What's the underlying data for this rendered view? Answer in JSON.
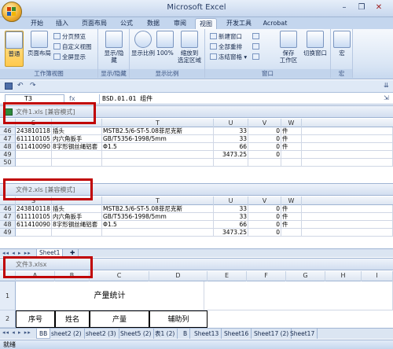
{
  "app": {
    "title": "Microsoft Excel"
  },
  "ribbon": {
    "tabs": [
      "开始",
      "插入",
      "页面布局",
      "公式",
      "数据",
      "审阅",
      "视图",
      "开发工具",
      "Acrobat"
    ],
    "active_tab": "视图",
    "groups": {
      "workbook_views": {
        "label": "工作簿视图",
        "normal": "普通",
        "page_layout": "页面布局",
        "page_break": "分页预览",
        "custom_views": "自定义视图",
        "full_screen": "全屏显示"
      },
      "show_hide": {
        "label": "显示/隐藏"
      },
      "zoom": {
        "label": "显示比例",
        "zoom": "显示比例",
        "zoom100": "100%",
        "zoom_selection_line1": "缩放到",
        "zoom_selection_line2": "选定区域"
      },
      "window": {
        "label": "窗口",
        "new_window": "新建窗口",
        "arrange_all": "全部重排",
        "freeze_panes": "冻结窗格",
        "save_workspace_line1": "保存",
        "save_workspace_line2": "工作区",
        "switch_windows": "切换窗口"
      },
      "macros": {
        "label": "宏",
        "macros": "宏"
      }
    }
  },
  "formula_bar": {
    "name_box": "T3",
    "fx": "fx",
    "value": "BSD.01.01 组件"
  },
  "windows": [
    {
      "title": "文件1.xls [兼容模式]",
      "columns": [
        "S",
        "T",
        "U",
        "V",
        "W"
      ],
      "rows": [
        {
          "n": "46",
          "cells": [
            "243810118",
            "插头",
            "MSTB2.5/6-ST-5.08菲尼克斯",
            "33",
            "0",
            "件"
          ]
        },
        {
          "n": "47",
          "cells": [
            "611110105",
            "内六角扳手",
            "GB/T5356-1998/5mm",
            "33",
            "0",
            "件"
          ]
        },
        {
          "n": "48",
          "cells": [
            "611410090",
            "8字形钢丝绳铝套",
            "Φ1.5",
            "66",
            "0",
            "件"
          ]
        },
        {
          "n": "49",
          "cells": [
            "",
            "",
            "",
            "3473.25",
            "0",
            ""
          ]
        },
        {
          "n": "50",
          "cells": [
            "",
            "",
            "",
            "",
            "",
            ""
          ]
        }
      ]
    },
    {
      "title": "文件2.xls [兼容模式]",
      "rows": [
        {
          "n": "46",
          "cells": [
            "243810118",
            "插头",
            "MSTB2.5/6-ST-5.08菲尼克斯",
            "33",
            "0",
            "件"
          ]
        },
        {
          "n": "47",
          "cells": [
            "611110105",
            "内六角扳手",
            "GB/T5356-1998/5mm",
            "33",
            "0",
            "件"
          ]
        },
        {
          "n": "48",
          "cells": [
            "611410090",
            "8字形钢丝绳铝套",
            "Φ1.5",
            "66",
            "0",
            "件"
          ]
        },
        {
          "n": "49",
          "cells": [
            "",
            "",
            "",
            "3473.25",
            "0",
            ""
          ]
        }
      ],
      "sheet_tab": "Sheet1"
    },
    {
      "title": "文件3.xlsx",
      "columns": [
        "A",
        "B",
        "C",
        "D",
        "E",
        "F",
        "G",
        "H",
        "I"
      ],
      "merged_title": "产量统计",
      "headers": [
        "序号",
        "姓名",
        "产量",
        "辅助列"
      ],
      "sheet_tabs": [
        "BB",
        "sheet2 (2)",
        "sheet2 (3)",
        "Sheet5 (2)",
        "表1 (2)",
        "B",
        "Sheet13",
        "Sheet16",
        "Sheet17 (2)",
        "Sheet17"
      ]
    }
  ],
  "status": {
    "text": "就绪"
  },
  "colors": {
    "accent": "#c00000",
    "ribbon": "#c4d6ee",
    "header": "#dde6f2"
  }
}
